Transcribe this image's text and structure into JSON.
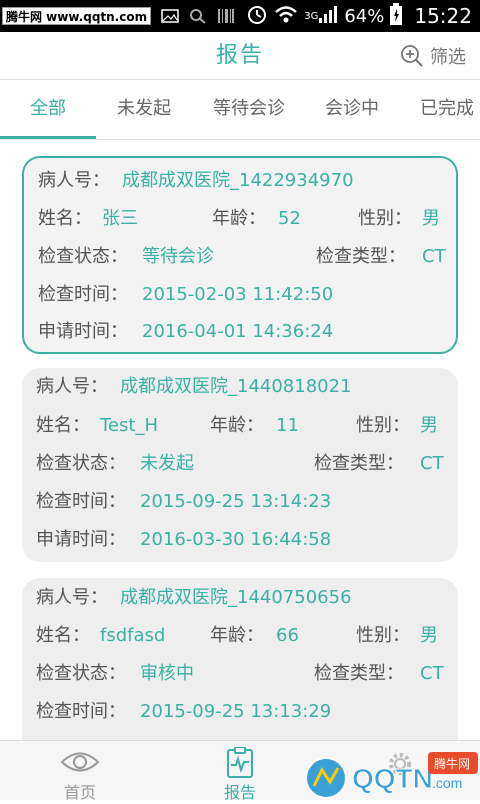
{
  "status_bar": {
    "watermark": "腾牛网 www.qqtn.com",
    "network": "3G",
    "battery": "64%",
    "time": "15:22"
  },
  "header": {
    "title": "报告",
    "filter_label": "筛选"
  },
  "tabs": [
    {
      "label": "全部",
      "active": true
    },
    {
      "label": "未发起",
      "active": false
    },
    {
      "label": "等待会诊",
      "active": false
    },
    {
      "label": "会诊中",
      "active": false
    },
    {
      "label": "已完成",
      "active": false
    }
  ],
  "labels": {
    "patient_no": "病人号：",
    "name": "姓名：",
    "age": "年龄：",
    "gender": "性别：",
    "check_status": "检查状态：",
    "check_type": "检查类型：",
    "check_time": "检查时间：",
    "apply_time": "申请时间："
  },
  "cards": [
    {
      "patient_no": "成都成双医院_1422934970",
      "name": "张三",
      "age": "52",
      "gender": "男",
      "check_status": "等待会诊",
      "check_type": "CT",
      "check_time": "2015-02-03 11:42:50",
      "apply_time": "2016-04-01 14:36:24",
      "selected": true
    },
    {
      "patient_no": "成都成双医院_1440818021",
      "name": "Test_H",
      "age": "11",
      "gender": "男",
      "check_status": "未发起",
      "check_type": "CT",
      "check_time": "2015-09-25 13:14:23",
      "apply_time": "2016-03-30 16:44:58",
      "selected": false
    },
    {
      "patient_no": "成都成双医院_1440750656",
      "name": "fsdfasd",
      "age": "66",
      "gender": "男",
      "check_status": "审核中",
      "check_type": "CT",
      "check_time": "2015-09-25 13:13:29",
      "selected": false
    }
  ],
  "bottom_nav": [
    {
      "label": "首页",
      "icon": "eye-icon",
      "active": false
    },
    {
      "label": "报告",
      "icon": "report-icon",
      "active": true
    },
    {
      "label": "",
      "icon": "gear-icon",
      "active": false
    }
  ],
  "corner_logo": {
    "text": "QQTN.com",
    "badge": "腾牛网"
  },
  "colors": {
    "accent": "#3ab1a4",
    "card_bg": "#eeeeee",
    "label": "#555555"
  }
}
